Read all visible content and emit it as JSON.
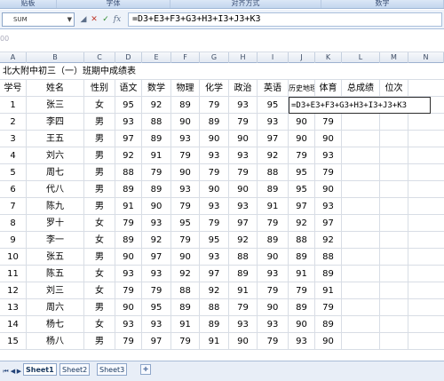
{
  "ribbon": {
    "groups": [
      "贴板",
      "字体",
      "对齐方式",
      "数字"
    ]
  },
  "formula_bar": {
    "name_box": "SUM",
    "cancel_icon": "cancel-icon",
    "enter_icon": "enter-icon",
    "fx_label": "fx",
    "formula": "=D3+E3+F3+G3+H3+I3+J3+K3"
  },
  "toolbar_strip": {
    "label": "00"
  },
  "columns": [
    "A",
    "B",
    "C",
    "D",
    "E",
    "F",
    "G",
    "H",
    "I",
    "J",
    "K",
    "L",
    "M",
    "N"
  ],
  "sheet": {
    "title": "北大附中初三（一）班期中成绩表",
    "headers": [
      "学号",
      "姓名",
      "性别",
      "语文",
      "数学",
      "物理",
      "化学",
      "政治",
      "英语",
      "历史地理综合",
      "体育",
      "总成绩",
      "位次"
    ],
    "formula_cell": "=D3+E3+F3+G3+H3+I3+J3+K3",
    "rows": [
      [
        "1",
        "张三",
        "女",
        "95",
        "92",
        "89",
        "79",
        "93",
        "95",
        "",
        ""
      ],
      [
        "2",
        "李四",
        "男",
        "93",
        "88",
        "90",
        "89",
        "79",
        "93",
        "90",
        "79"
      ],
      [
        "3",
        "王五",
        "男",
        "97",
        "89",
        "93",
        "90",
        "90",
        "97",
        "90",
        "90"
      ],
      [
        "4",
        "刘六",
        "男",
        "92",
        "91",
        "79",
        "93",
        "93",
        "92",
        "79",
        "93"
      ],
      [
        "5",
        "周七",
        "男",
        "88",
        "79",
        "90",
        "79",
        "79",
        "88",
        "95",
        "79"
      ],
      [
        "6",
        "代八",
        "男",
        "89",
        "89",
        "93",
        "90",
        "90",
        "89",
        "95",
        "90"
      ],
      [
        "7",
        "陈九",
        "男",
        "91",
        "90",
        "79",
        "93",
        "93",
        "91",
        "97",
        "93"
      ],
      [
        "8",
        "罗十",
        "女",
        "79",
        "93",
        "95",
        "79",
        "97",
        "79",
        "92",
        "97"
      ],
      [
        "9",
        "李一",
        "女",
        "89",
        "92",
        "79",
        "95",
        "92",
        "89",
        "88",
        "92"
      ],
      [
        "10",
        "张五",
        "男",
        "90",
        "97",
        "90",
        "93",
        "88",
        "90",
        "89",
        "88"
      ],
      [
        "11",
        "陈五",
        "女",
        "93",
        "93",
        "92",
        "97",
        "89",
        "93",
        "91",
        "89"
      ],
      [
        "12",
        "刘三",
        "女",
        "79",
        "79",
        "88",
        "92",
        "91",
        "79",
        "79",
        "91"
      ],
      [
        "13",
        "周六",
        "男",
        "90",
        "95",
        "89",
        "88",
        "79",
        "90",
        "89",
        "79"
      ],
      [
        "14",
        "杨七",
        "女",
        "93",
        "93",
        "91",
        "89",
        "93",
        "93",
        "90",
        "89"
      ],
      [
        "15",
        "杨八",
        "男",
        "79",
        "97",
        "79",
        "91",
        "90",
        "79",
        "93",
        "90"
      ]
    ]
  },
  "tabs": {
    "items": [
      "Sheet1",
      "Sheet2",
      "Sheet3"
    ],
    "active": "Sheet1"
  },
  "colors": {
    "grid_line": "#d8dde5",
    "header_bg": "#e3e9f2",
    "ribbon_bg": "#c3d6ee"
  }
}
